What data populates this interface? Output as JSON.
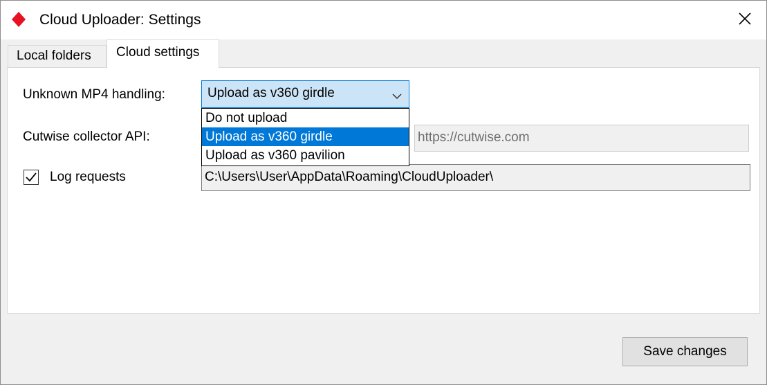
{
  "window": {
    "title": "Cloud Uploader: Settings",
    "accent_color": "#e81123",
    "icon": "red-diamond-icon"
  },
  "tabs": [
    {
      "label": "Local folders",
      "active": false
    },
    {
      "label": "Cloud settings",
      "active": true
    }
  ],
  "form": {
    "mp4_label": "Unknown MP4 handling:",
    "mp4_value": "Upload as v360 girdle",
    "mp4_options": [
      "Do not upload",
      "Upload as v360 girdle",
      "Upload as v360 pavilion"
    ],
    "mp4_selected_index": 1,
    "api_label": "Cutwise collector API:",
    "api_value": "https://cutwise.com",
    "log_label": "Log requests",
    "log_checked": true,
    "log_path": "C:\\Users\\User\\AppData\\Roaming\\CloudUploader\\"
  },
  "footer": {
    "save_label": "Save changes"
  },
  "colors": {
    "selection": "#0078d7",
    "combo_background": "#cce4f7"
  }
}
